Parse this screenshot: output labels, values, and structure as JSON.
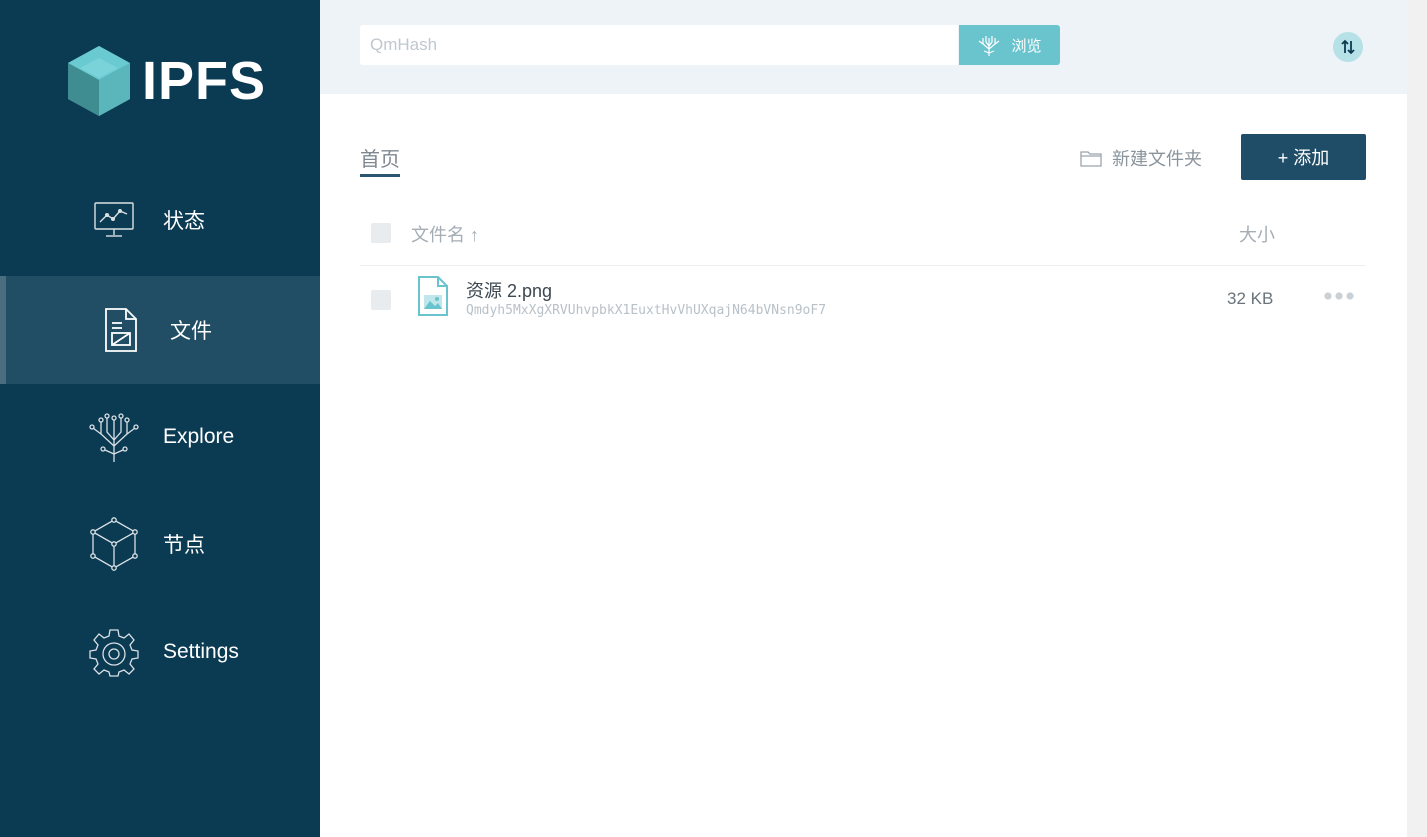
{
  "app": {
    "logo_text": "IPFS"
  },
  "sidebar": {
    "items": [
      {
        "label": "状态",
        "icon": "status-monitor-icon",
        "active": false
      },
      {
        "label": "文件",
        "icon": "files-icon",
        "active": true
      },
      {
        "label": "Explore",
        "icon": "explore-tree-icon",
        "active": false
      },
      {
        "label": "节点",
        "icon": "peers-cube-icon",
        "active": false
      },
      {
        "label": "Settings",
        "icon": "gear-icon",
        "active": false
      }
    ]
  },
  "topbar": {
    "search_placeholder": "QmHash",
    "search_value": "",
    "browse_label": "浏览",
    "connection_icon": "connection-arrows-icon"
  },
  "files": {
    "breadcrumb": "首页",
    "new_folder_label": "新建文件夹",
    "add_label": "+ 添加",
    "columns": {
      "name": "文件名 ↑",
      "size": "大小"
    },
    "rows": [
      {
        "name": "资源 2.png",
        "hash": "Qmdyh5MxXgXRVUhvpbkX1EuxtHvVhUXqajN64bVNsn9oF7",
        "size": "32 KB",
        "icon": "image-file-icon"
      }
    ]
  },
  "colors": {
    "sidebar_bg": "#0b3a53",
    "sidebar_active": "#224e65",
    "accent_teal": "#69c4cd",
    "primary_button": "#1f4c67",
    "topbar_bg": "#eef3f8"
  }
}
